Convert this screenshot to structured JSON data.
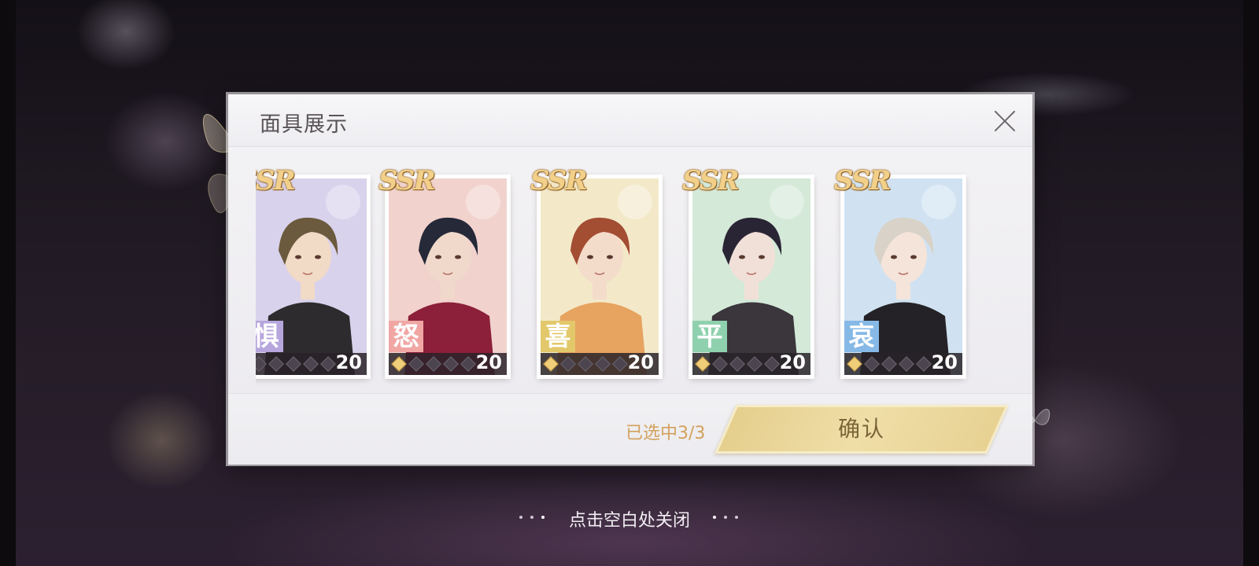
{
  "dialog": {
    "title": "面具展示",
    "selected_text": "已选中3/3",
    "confirm_label": "确认"
  },
  "hint": "点击空白处关闭",
  "cards": [
    {
      "rarity": "SSR",
      "emotion": "惧",
      "level": "20",
      "tag_color": "#b7a6dd",
      "bg_color": "#d9d2ec",
      "hair": "#6b5a3e",
      "skin": "#f1dac6",
      "cloth": "#2e2b2e",
      "gems_on": 0
    },
    {
      "rarity": "SSR",
      "emotion": "怒",
      "level": "20",
      "tag_color": "#f0a7a4",
      "bg_color": "#f1d2cd",
      "hair": "#252938",
      "skin": "#f0d9cb",
      "cloth": "#8c1f3a",
      "gems_on": 1
    },
    {
      "rarity": "SSR",
      "emotion": "喜",
      "level": "20",
      "tag_color": "#e2c86a",
      "bg_color": "#f3e9c9",
      "hair": "#a34d33",
      "skin": "#f4dccb",
      "cloth": "#e7a360",
      "gems_on": 1
    },
    {
      "rarity": "SSR",
      "emotion": "平",
      "level": "20",
      "tag_color": "#8fd1ae",
      "bg_color": "#d4e9d8",
      "hair": "#2a2535",
      "skin": "#f1e0d8",
      "cloth": "#3b353c",
      "gems_on": 1
    },
    {
      "rarity": "SSR",
      "emotion": "哀",
      "level": "20",
      "tag_color": "#86b9e6",
      "bg_color": "#d0e2f1",
      "hair": "#d8d2c8",
      "skin": "#f5e4da",
      "cloth": "#242226",
      "gems_on": 1
    }
  ]
}
